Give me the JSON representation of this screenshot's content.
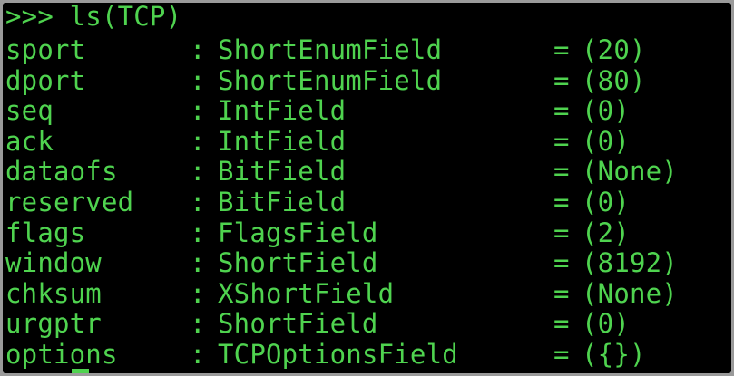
{
  "prompt": ">>> ls(TCP)",
  "separator": ":",
  "equals": "=",
  "fields": [
    {
      "name": "sport",
      "type": "ShortEnumField",
      "default": "(20)"
    },
    {
      "name": "dport",
      "type": "ShortEnumField",
      "default": "(80)"
    },
    {
      "name": "seq",
      "type": "IntField",
      "default": "(0)"
    },
    {
      "name": "ack",
      "type": "IntField",
      "default": "(0)"
    },
    {
      "name": "dataofs",
      "type": "BitField",
      "default": "(None)"
    },
    {
      "name": "reserved",
      "type": "BitField",
      "default": "(0)"
    },
    {
      "name": "flags",
      "type": "FlagsField",
      "default": "(2)"
    },
    {
      "name": "window",
      "type": "ShortField",
      "default": "(8192)"
    },
    {
      "name": "chksum",
      "type": "XShortField",
      "default": "(None)"
    },
    {
      "name": "urgptr",
      "type": "ShortField",
      "default": "(0)"
    },
    {
      "name": "options",
      "type": "TCPOptionsField",
      "default": "({})"
    }
  ],
  "colors": {
    "text": "#4fd34f",
    "background": "#000000"
  }
}
